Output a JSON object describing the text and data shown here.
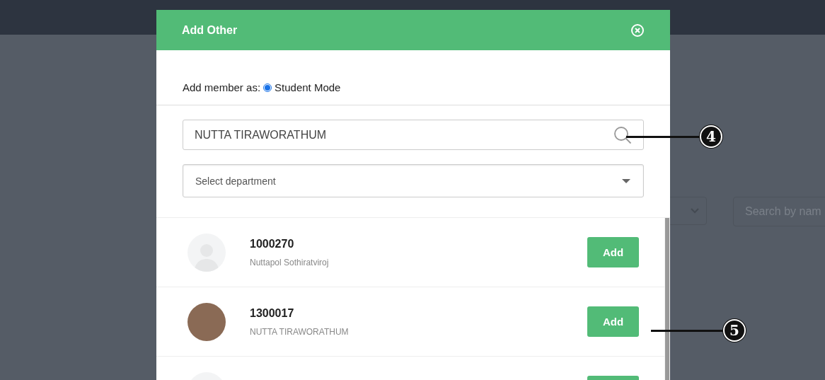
{
  "background": {
    "select": {
      "kind": "dropdown"
    },
    "search": {
      "placeholder": "Search by nam"
    }
  },
  "dialog": {
    "title": "Add Other",
    "mode_label": "Add member as:",
    "modes": [
      {
        "label": "Student Mode",
        "selected": true
      }
    ],
    "search": {
      "value": "NUTTA TIRAWORATHUM"
    },
    "department": {
      "placeholder": "Select department"
    },
    "results": [
      {
        "kind": "placeholder",
        "id": "1000270",
        "name": "Nuttapol Sothiratviroj",
        "button": "Add"
      },
      {
        "kind": "photo",
        "id": "1300017",
        "name": "NUTTA TIRAWORATHUM",
        "button": "Add"
      },
      {
        "kind": "placeholder"
      }
    ]
  },
  "annotations": [
    {
      "label": "4",
      "kind": "search"
    },
    {
      "label": "5",
      "kind": "button"
    }
  ]
}
